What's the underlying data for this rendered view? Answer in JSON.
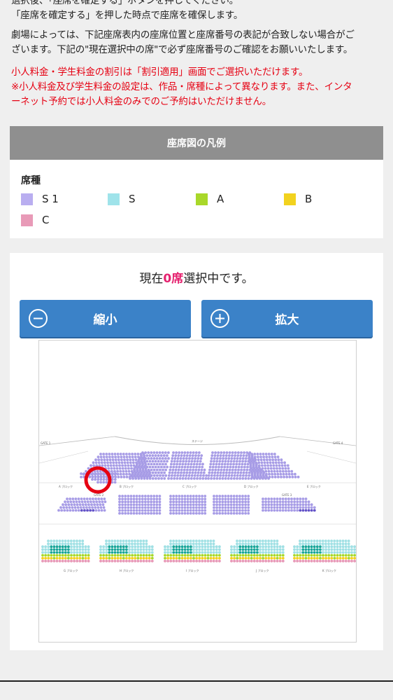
{
  "intro": {
    "line1": "選択後、「座席を確定する」ボタンを押してください。",
    "line2": "「座席を確定する」を押した時点で座席を確保します。",
    "line3": "劇場によっては、下記座席表内の座席位置と座席番号の表記が合致しない場合がご",
    "line4": "ざいます。下記の\"現在選択中の席\"で必ず座席番号のご確認をお願いいたします。",
    "notice1": "小人料金・学生料金の割引は「割引適用」画面でご選択いただけます。",
    "notice2": "※小人料金及び学生料金の設定は、作品・席種によって異なります。また、インタ",
    "notice3": "ーネット予約では小人料金のみでのご予約はいただけません。"
  },
  "legend": {
    "header": "座席図の凡例",
    "title": "席種",
    "items": [
      {
        "label": "S 1",
        "color": "#b9aef0"
      },
      {
        "label": "S",
        "color": "#9fe3ea"
      },
      {
        "label": "A",
        "color": "#a9d82a"
      },
      {
        "label": "B",
        "color": "#f2d21e"
      },
      {
        "label": "C",
        "color": "#e89ab7"
      }
    ]
  },
  "selection": {
    "prefix": "現在",
    "count": "0席",
    "suffix": "選択中です。"
  },
  "buttons": {
    "zoom_out": "縮小",
    "zoom_in": "拡大"
  },
  "map": {
    "stage": "ステージ",
    "gates": [
      "GATE 1",
      "GATE 4",
      "GATE 2",
      "GATE 3"
    ],
    "blocks_upper": [
      "A ブロック",
      "B ブロック",
      "C ブロック",
      "D ブロック",
      "E ブロック"
    ],
    "blocks_lower": [
      "G ブロック",
      "H ブロック",
      "I ブロック",
      "J ブロック",
      "K ブロック"
    ],
    "colors": {
      "s1": "#a79ce6",
      "s1_dark": "#6454c8",
      "s": "#9fe0e4",
      "s_dark": "#1aa69a",
      "a": "#a9d82a",
      "b": "#f2d21e",
      "c": "#e89ab7",
      "marker": "#e60012"
    }
  }
}
